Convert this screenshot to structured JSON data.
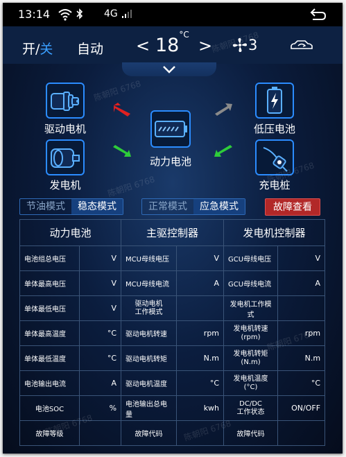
{
  "status_bar": {
    "time": "13:14",
    "network": "4G"
  },
  "controls": {
    "power_on": "开",
    "slash": "/",
    "power_off": "关",
    "auto": "自动",
    "temp_left_arrow": "<",
    "temperature": "18",
    "temp_unit": "°C",
    "temp_right_arrow": ">",
    "fan_level": "3"
  },
  "components": {
    "drive_motor": "驱动电机",
    "low_voltage_battery": "低压电池",
    "power_battery": "动力电池",
    "generator": "发电机",
    "charging_pile": "充电桩"
  },
  "modes": {
    "economy": "节油模式",
    "steady": "稳态模式",
    "normal": "正常模式",
    "emergency": "应急模式",
    "fault_view": "故障查看"
  },
  "table": {
    "headers": [
      "动力电池",
      "主驱控制器",
      "发电机控制器"
    ],
    "rows": [
      [
        "电池组总电压",
        "V",
        "MCU母线电压",
        "V",
        "GCU母线电压",
        "V"
      ],
      [
        "单体最高电压",
        "V",
        "MCU母线电流",
        "A",
        "GCU母线电流",
        "A"
      ],
      [
        "单体最低电压",
        "V",
        "驱动电机\n工作模式",
        "",
        "发电机工作模式",
        ""
      ],
      [
        "单体最高温度",
        "°C",
        "驱动电机转速",
        "rpm",
        "发电机转速\n(rpm)",
        "rpm"
      ],
      [
        "单体最低温度",
        "°C",
        "驱动电机转矩",
        "N.m",
        "发电机转矩\n(N.m)",
        "N.m"
      ],
      [
        "电池输出电流",
        "A",
        "驱动电机温度",
        "°C",
        "发电机温度\n(°C)",
        "°C"
      ],
      [
        "电池SOC",
        "%",
        "电池输出总电量",
        "kwh",
        "DC/DC\n工作状态",
        "ON/OFF"
      ],
      [
        "故障等级",
        "",
        "故障代码",
        "",
        "故障代码",
        ""
      ]
    ]
  },
  "watermark": "陈朝阳 6768",
  "colors": {
    "accent": "#2b8cff",
    "fault": "#b22828",
    "arrow_red": "#e02020",
    "arrow_green": "#2ecc3a",
    "arrow_gray": "#8a8a8a"
  }
}
